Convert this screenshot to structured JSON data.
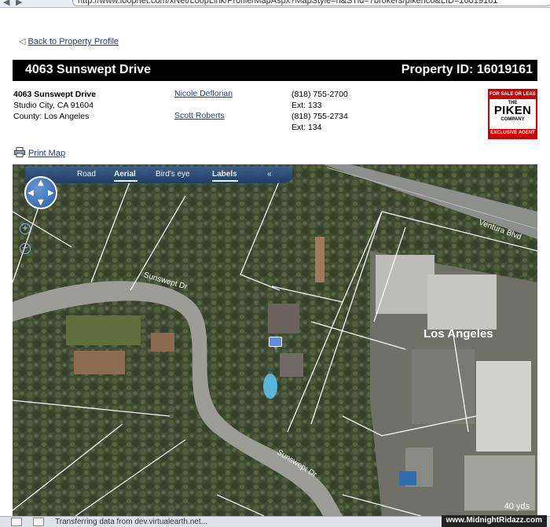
{
  "browser": {
    "url": "http://www.loopnet.com/xNet/LoopLink/Profile/MapAspx?MapStyle=h&STid=7brokers/pikenco&LID=16019161"
  },
  "nav": {
    "back_label": "Back to Property Profile"
  },
  "header": {
    "address": "4063 Sunswept Drive",
    "property_id": "Property ID: 16019161"
  },
  "property": {
    "street": "4063 Sunswept Drive",
    "city_line": "Studio City, CA 91604",
    "county_line": "County: Los Angeles"
  },
  "agents": [
    {
      "name": "Nicole Deflorian",
      "phone": "(818) 755-2700",
      "ext": "Ext: 133"
    },
    {
      "name": "Scott Roberts",
      "phone": "(818) 755-2734",
      "ext": "Ext: 134"
    }
  ],
  "logo": {
    "top": "FOR SALE OR LEASE",
    "the": "THE",
    "name": "PIKEN",
    "company": "COMPANY",
    "bottom": "EXCLUSIVE AGENT"
  },
  "print": {
    "label": "Print Map"
  },
  "map": {
    "tabs": [
      {
        "label": "Road",
        "active": false
      },
      {
        "label": "Aerial",
        "active": true
      },
      {
        "label": "Bird's eye",
        "active": false
      },
      {
        "label": "Labels",
        "active": true
      }
    ],
    "collapse_label": "«",
    "zoom_in": "+",
    "zoom_out": "−",
    "street_labels": [
      "Sunswept Dr",
      "Sunswept Dr",
      "Ventura Blvd"
    ],
    "city_label": "Los Angeles",
    "scale": "40 yds"
  },
  "status": {
    "text": "Transferring data from dev.virtualearth.net...",
    "watermark": "www.MidnightRidazz.com"
  }
}
